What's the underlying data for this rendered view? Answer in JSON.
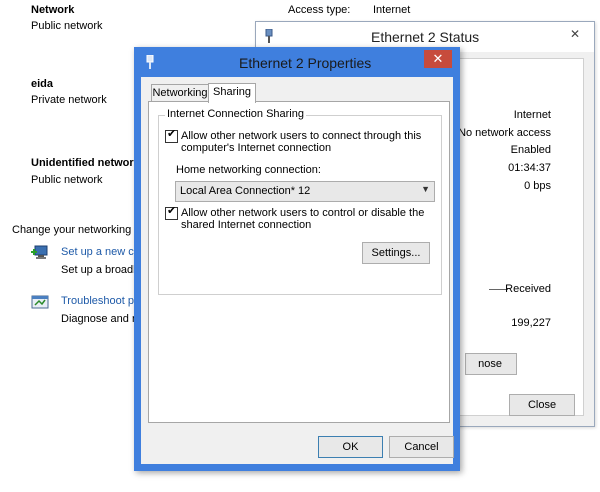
{
  "background": {
    "networks": [
      {
        "name": "Network",
        "type": "Public network"
      },
      {
        "name": "eida",
        "type": "Private network"
      },
      {
        "name": "Unidentified network",
        "type": "Public network"
      }
    ],
    "change_settings_label": "Change your networking s",
    "tasks": [
      {
        "title": "Set up a new co",
        "desc": "Set up a broadb"
      },
      {
        "title": "Troubleshoot p",
        "desc": "Diagnose and re"
      }
    ],
    "access_type_label": "Access type:",
    "access_type_value": "Internet"
  },
  "status_window": {
    "title": "Ethernet 2 Status",
    "close_glyph": "✕",
    "values": [
      "Internet",
      "No network access",
      "Enabled",
      "01:34:37",
      "0 bps"
    ],
    "received_label": "Received",
    "received_value": "199,227",
    "partial_button": "nose",
    "close_button": "Close"
  },
  "properties_dialog": {
    "title": "Ethernet 2 Properties",
    "close_glyph": "✕",
    "tabs": [
      {
        "label": "Networking",
        "active": false
      },
      {
        "label": "Sharing",
        "active": true
      }
    ],
    "group_title": "Internet Connection Sharing",
    "allow_connect_line1": "Allow other network users to connect through this",
    "allow_connect_line2": "computer's Internet connection",
    "allow_connect_checked": true,
    "home_networking_label": "Home networking connection:",
    "home_networking_value": "Local Area Connection* 12",
    "allow_control_line1": "Allow other network users to control or disable the",
    "allow_control_line2": "shared Internet connection",
    "allow_control_checked": true,
    "settings_button": "Settings...",
    "ok_button": "OK",
    "cancel_button": "Cancel"
  }
}
